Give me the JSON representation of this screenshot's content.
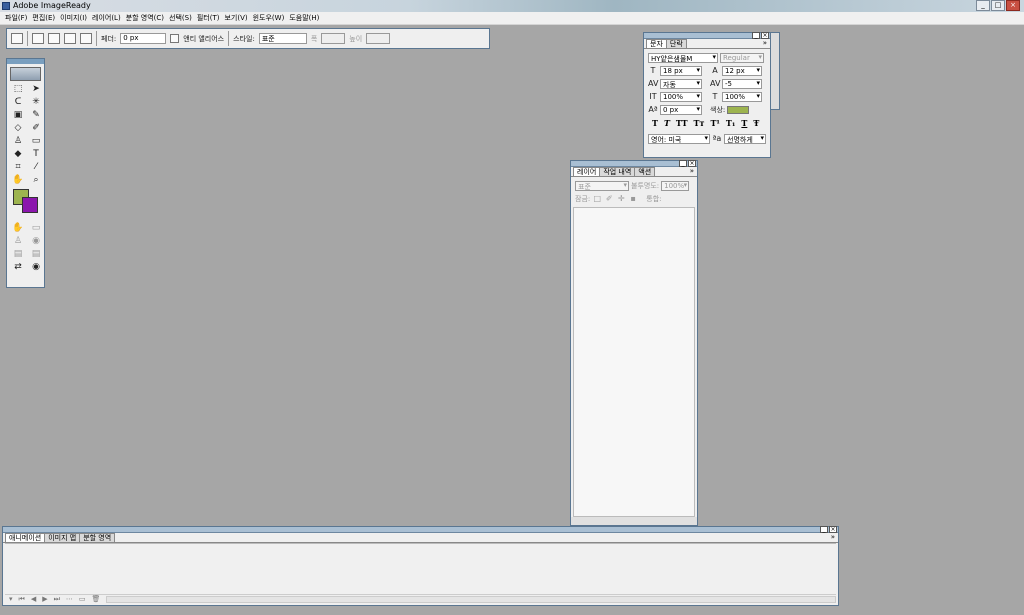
{
  "window": {
    "title": "Adobe ImageReady",
    "controls": [
      "_",
      "□",
      "×"
    ]
  },
  "menu": [
    "파일(F)",
    "편집(E)",
    "이미지(I)",
    "레이어(L)",
    "분할 영역(C)",
    "선택(S)",
    "필터(T)",
    "보기(V)",
    "윈도우(W)",
    "도움말(H)"
  ],
  "options": {
    "feather_label": "페더:",
    "feather_value": "0 px",
    "antialias_label": "앤티 앨리어스",
    "style_label": "스타일:",
    "style_value": "표준",
    "width_label": "폭",
    "height_label": "높이"
  },
  "colors": {
    "foreground": "#9db44f",
    "background": "#8b16ad"
  },
  "character": {
    "tabs": [
      "문자",
      "단락"
    ],
    "font": "HY얕은샘물M",
    "font_style": "Regular",
    "size": "18 px",
    "leading": "12 px",
    "tracking": "자동",
    "kerning": "-5",
    "vscale": "100%",
    "hscale": "100%",
    "baseline": "0 px",
    "color_label": "색상:",
    "style_buttons": [
      "T",
      "T",
      "TT",
      "Tт",
      "T¹",
      "T₁",
      "T",
      "Ŧ"
    ],
    "language": "영어: 미국",
    "antialias": "선명하게",
    "aa_icon": "ªa"
  },
  "layers": {
    "tabs": [
      "레이어",
      "작업 내역",
      "액션"
    ],
    "blend_mode": "표준",
    "opacity_label": "불투명도:",
    "opacity_value": "100%",
    "lock_label": "잠금:",
    "unify_label": "통합:"
  },
  "animation": {
    "tabs": [
      "애니메이션",
      "이미지 맵",
      "분할 영역"
    ]
  }
}
